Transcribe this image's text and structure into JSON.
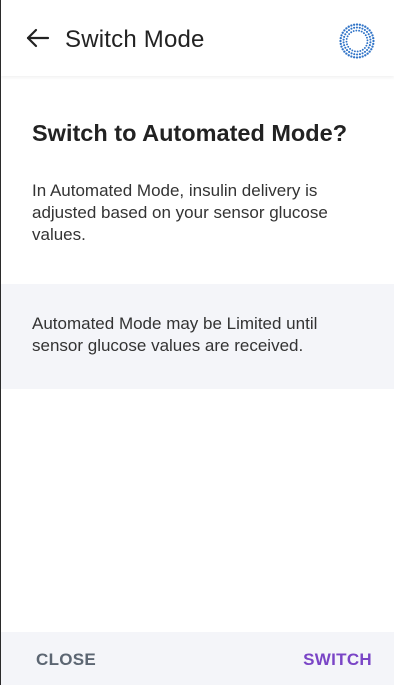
{
  "header": {
    "title": "Switch Mode",
    "back_icon": "arrow-left-icon",
    "status_icon": "sensor-dotted-circle-icon"
  },
  "content": {
    "heading": "Switch to Automated Mode?",
    "body": "In Automated Mode, insulin delivery is adjusted based on your sensor glucose values.",
    "info": "Automated Mode may be Limited until sensor glucose values are received."
  },
  "footer": {
    "close_label": "CLOSE",
    "switch_label": "SWITCH"
  },
  "colors": {
    "accent": "#7a45c6",
    "secondary_button": "#5c6672",
    "panel_background": "#f4f5f9",
    "status_icon": "#2f73c7"
  }
}
